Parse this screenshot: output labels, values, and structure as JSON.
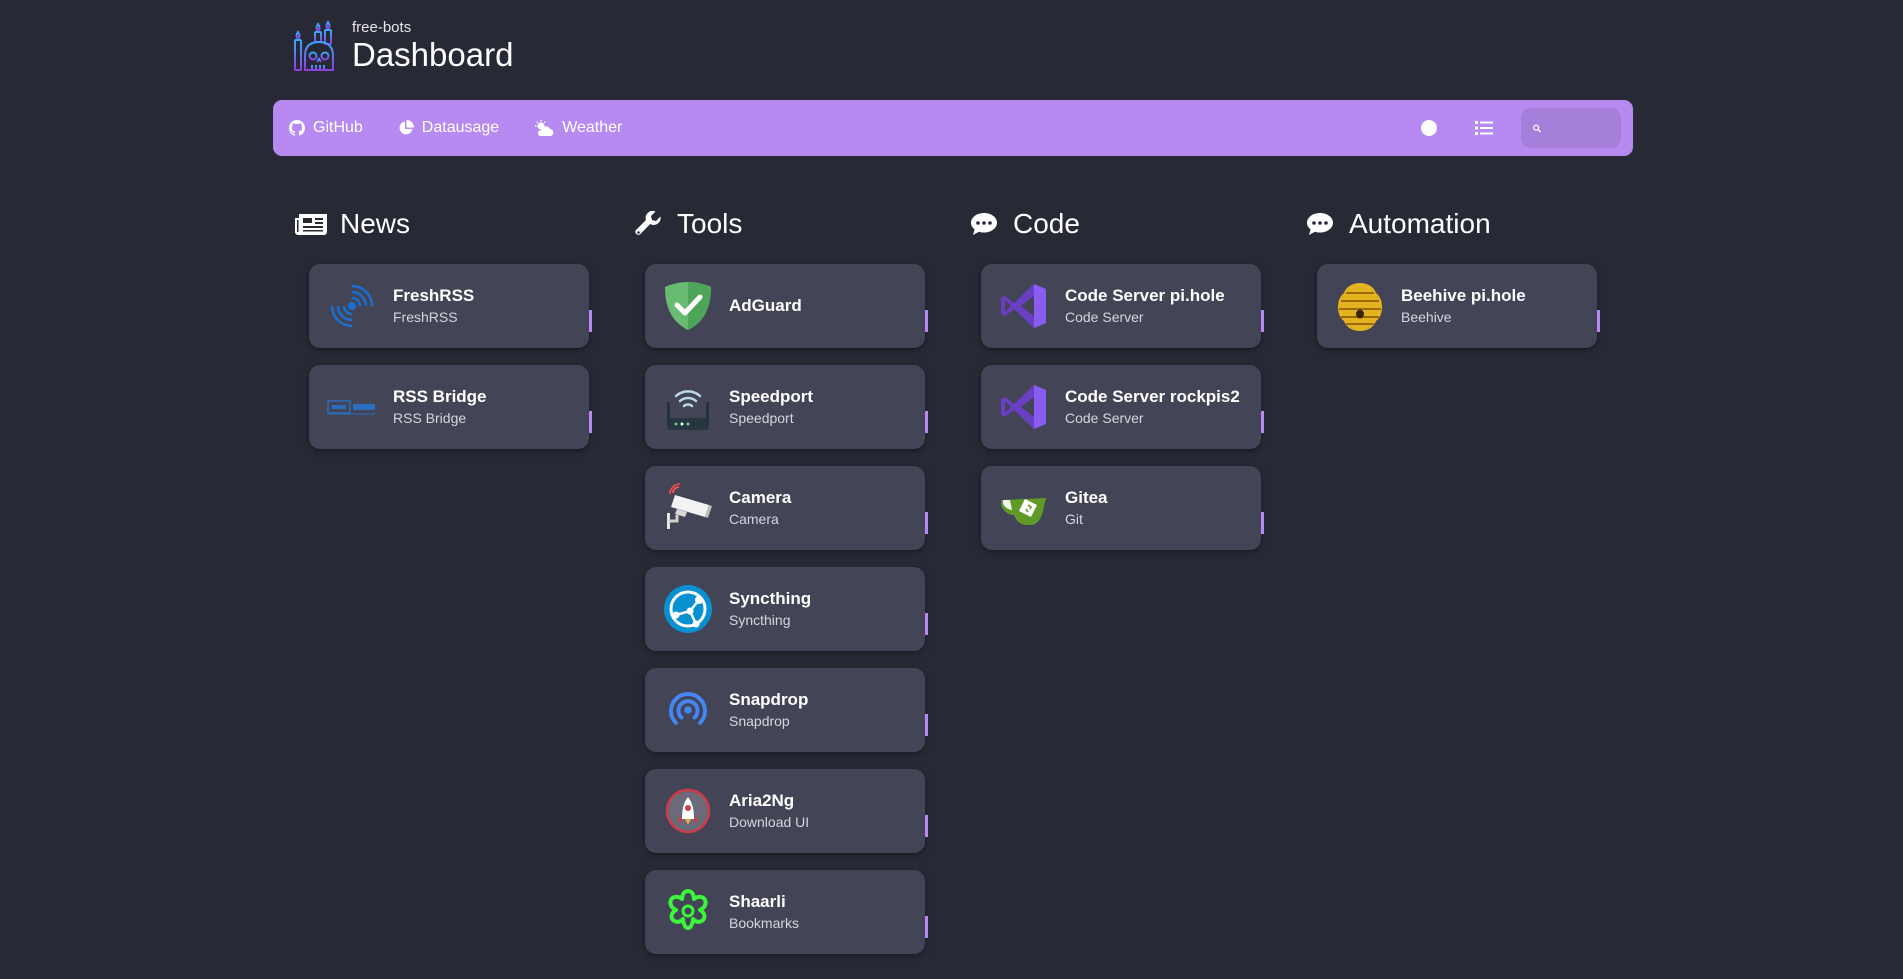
{
  "header": {
    "subtitle": "free-bots",
    "title": "Dashboard"
  },
  "navbar": {
    "links": [
      {
        "label": "GitHub",
        "icon": "github-icon"
      },
      {
        "label": "Datausage",
        "icon": "pie-chart-icon"
      },
      {
        "label": "Weather",
        "icon": "cloud-sun-icon"
      }
    ],
    "accent_color": "#b68af1"
  },
  "sections": [
    {
      "title": "News",
      "icon": "newspaper-icon",
      "items": [
        {
          "name": "FreshRSS",
          "subtitle": "FreshRSS",
          "icon": "freshrss-icon"
        },
        {
          "name": "RSS Bridge",
          "subtitle": "RSS Bridge",
          "icon": "rss-bridge-icon"
        }
      ]
    },
    {
      "title": "Tools",
      "icon": "wrench-icon",
      "items": [
        {
          "name": "AdGuard",
          "subtitle": "",
          "icon": "adguard-shield-icon"
        },
        {
          "name": "Speedport",
          "subtitle": "Speedport",
          "icon": "router-icon"
        },
        {
          "name": "Camera",
          "subtitle": "Camera",
          "icon": "security-camera-icon"
        },
        {
          "name": "Syncthing",
          "subtitle": "Syncthing",
          "icon": "syncthing-icon"
        },
        {
          "name": "Snapdrop",
          "subtitle": "Snapdrop",
          "icon": "snapdrop-icon"
        },
        {
          "name": "Aria2Ng",
          "subtitle": "Download UI",
          "icon": "aria2ng-icon"
        },
        {
          "name": "Shaarli",
          "subtitle": "Bookmarks",
          "icon": "shaarli-icon"
        }
      ]
    },
    {
      "title": "Code",
      "icon": "comment-icon",
      "items": [
        {
          "name": "Code Server pi.hole",
          "subtitle": "Code Server",
          "icon": "vscode-icon"
        },
        {
          "name": "Code Server rockpis2",
          "subtitle": "Code Server",
          "icon": "vscode-icon"
        },
        {
          "name": "Gitea",
          "subtitle": "Git",
          "icon": "gitea-icon"
        }
      ]
    },
    {
      "title": "Automation",
      "icon": "comment-icon",
      "items": [
        {
          "name": "Beehive pi.hole",
          "subtitle": "Beehive",
          "icon": "beehive-icon"
        }
      ]
    }
  ]
}
